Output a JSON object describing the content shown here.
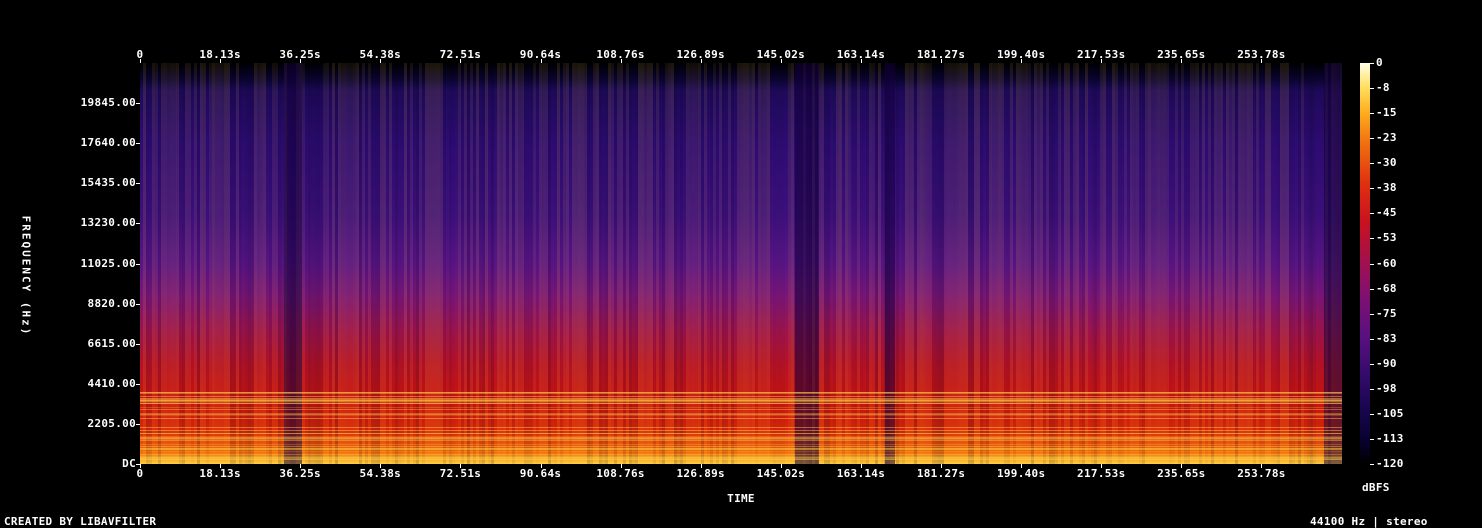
{
  "chart_data": {
    "type": "heatmap",
    "title": "",
    "xlabel": "TIME",
    "ylabel": "FREQUENCY (Hz)",
    "x_ticks": [
      "0",
      "18.13s",
      "36.25s",
      "54.38s",
      "72.51s",
      "90.64s",
      "108.76s",
      "126.89s",
      "145.02s",
      "163.14s",
      "181.27s",
      "199.40s",
      "217.53s",
      "235.65s",
      "253.78s"
    ],
    "x_tick_values": [
      0,
      18.13,
      36.25,
      54.38,
      72.51,
      90.64,
      108.76,
      126.89,
      145.02,
      163.14,
      181.27,
      199.4,
      217.53,
      235.65,
      253.78
    ],
    "xlim": [
      0,
      272
    ],
    "y_ticks": [
      "DC",
      "2205.00",
      "4410.00",
      "6615.00",
      "8820.00",
      "11025.00",
      "13230.00",
      "15435.00",
      "17640.00",
      "19845.00"
    ],
    "y_tick_values": [
      0,
      2205,
      4410,
      6615,
      8820,
      11025,
      13230,
      15435,
      17640,
      19845
    ],
    "ylim": [
      0,
      22050
    ],
    "colorbar": {
      "label": "dBFS",
      "ticks": [
        "0",
        "-8",
        "-15",
        "-23",
        "-30",
        "-38",
        "-45",
        "-53",
        "-60",
        "-68",
        "-75",
        "-83",
        "-90",
        "-98",
        "-105",
        "-113",
        "-120"
      ],
      "range": [
        -120,
        0
      ]
    },
    "grid": false
  },
  "footer": {
    "left": "CREATED BY LIBAVFILTER",
    "right": "44100 Hz | stereo"
  },
  "colors": {
    "background": "#000000",
    "text": "#ffffff",
    "low_energy": "#1f0a5a",
    "mid_energy": "#c8140f",
    "high_energy": "#ffd040"
  }
}
